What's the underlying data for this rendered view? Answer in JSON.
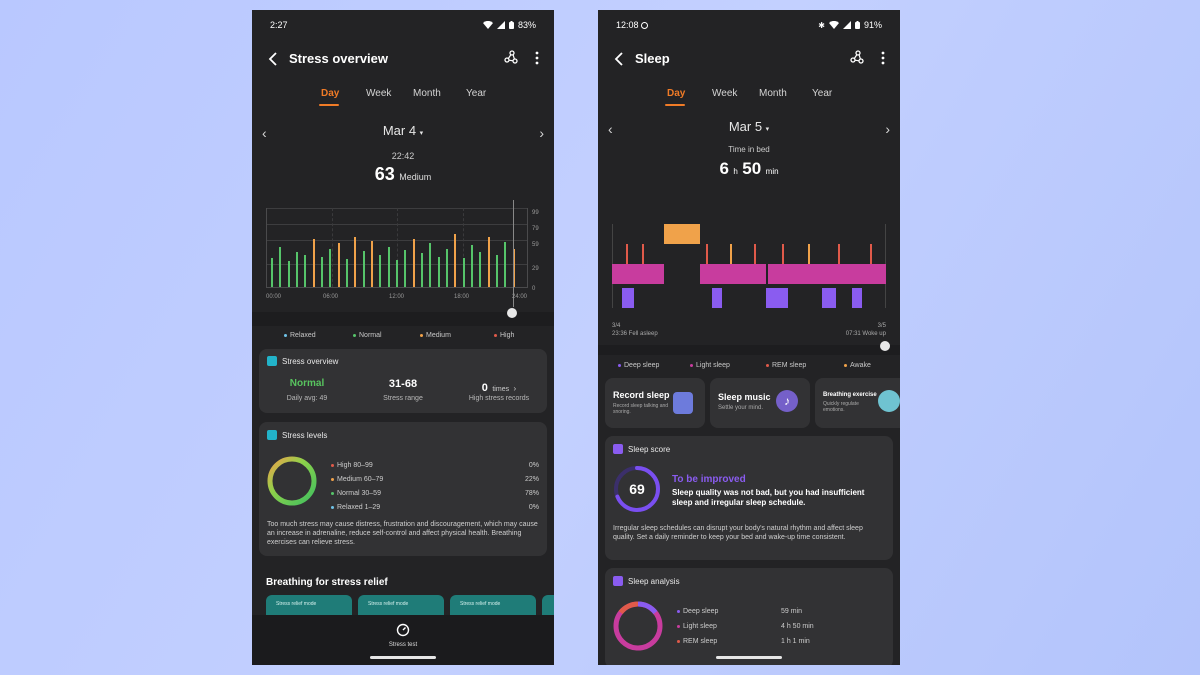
{
  "left_phone": {
    "status": {
      "time": "2:27",
      "battery": "83%"
    },
    "title": "Stress overview",
    "tabs": [
      "Day",
      "Week",
      "Month",
      "Year"
    ],
    "date": "Mar 4",
    "reading": {
      "time": "22:42",
      "value": "63",
      "level": "Medium"
    },
    "chart_data": {
      "type": "bar",
      "y_ticks": [
        "99",
        "79",
        "59",
        "29",
        "0"
      ],
      "x_ticks": [
        "00:00",
        "06:00",
        "12:00",
        "18:00",
        "24:00"
      ],
      "ylim": [
        0,
        99
      ]
    },
    "legend": [
      {
        "label": "Relaxed",
        "color": "#6fc3e8"
      },
      {
        "label": "Normal",
        "color": "#56c46a"
      },
      {
        "label": "Medium",
        "color": "#f0a24a"
      },
      {
        "label": "High",
        "color": "#e05a4a"
      }
    ],
    "overview_card": {
      "title": "Stress overview",
      "normal_label": "Normal",
      "daily_avg_label": "Daily avg:",
      "daily_avg_value": "49",
      "range_value": "31-68",
      "range_label": "Stress range",
      "times_value": "0",
      "times_unit": "times",
      "times_label": "High stress records"
    },
    "levels_card": {
      "title": "Stress levels",
      "rows": [
        {
          "label": "High 80–99",
          "pct": "0%",
          "color": "#e05a4a"
        },
        {
          "label": "Medium 60–79",
          "pct": "22%",
          "color": "#f0a24a"
        },
        {
          "label": "Normal 30–59",
          "pct": "78%",
          "color": "#56c46a"
        },
        {
          "label": "Relaxed 1–29",
          "pct": "0%",
          "color": "#6fc3e8"
        }
      ],
      "description": "Too much stress may cause distress, frustration and discouragement, which may cause an increase in adrenaline, reduce self-control and affect physical health. Breathing exercises can relieve stress."
    },
    "breathing": {
      "title": "Breathing for stress relief",
      "card_label": "Stress relief mode"
    },
    "bottom_button": "Stress test"
  },
  "right_phone": {
    "status": {
      "time": "12:08",
      "battery": "91%"
    },
    "title": "Sleep",
    "tabs": [
      "Day",
      "Week",
      "Month",
      "Year"
    ],
    "date": "Mar 5",
    "time_in_bed_label": "Time in bed",
    "time_in_bed": {
      "hours": "6",
      "h_unit": "h",
      "minutes": "50",
      "min_unit": "min"
    },
    "start": {
      "date": "3/4",
      "time": "23:36 Fell asleep"
    },
    "end": {
      "date": "3/5",
      "time": "07:31 Woke up"
    },
    "legend": [
      {
        "label": "Deep sleep",
        "color": "#8a5cf0"
      },
      {
        "label": "Light sleep",
        "color": "#c83c9e"
      },
      {
        "label": "REM sleep",
        "color": "#e05a4a"
      },
      {
        "label": "Awake",
        "color": "#f0a24a"
      }
    ],
    "tiles": [
      {
        "title": "Record sleep",
        "sub": "Record sleep talking and snoring."
      },
      {
        "title": "Sleep music",
        "sub": "Settle your mind."
      },
      {
        "title": "Breathing exercise",
        "sub": "Quickly regulate emotions."
      }
    ],
    "score_card": {
      "title": "Sleep score",
      "score": "69",
      "score_fraction": 0.69,
      "status": "To be improved",
      "headline": "Sleep quality was not bad, but you had insufficient sleep and irregular sleep schedule.",
      "description": "Irregular sleep schedules can disrupt your body's natural rhythm and affect sleep quality. Set a daily reminder to keep your bed and wake-up time consistent."
    },
    "analysis_card": {
      "title": "Sleep analysis",
      "rows": [
        {
          "label": "Deep sleep",
          "value": "59 min",
          "color": "#8a5cf0"
        },
        {
          "label": "Light sleep",
          "value": "4 h 50 min",
          "color": "#c83c9e"
        },
        {
          "label": "REM sleep",
          "value": "1 h 1 min",
          "color": "#e05a4a"
        }
      ]
    }
  }
}
